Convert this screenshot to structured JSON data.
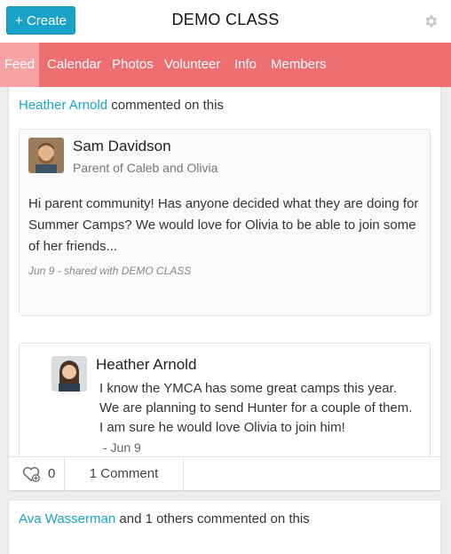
{
  "header": {
    "create_label": "+ Create",
    "class_title": "DEMO CLASS"
  },
  "nav": {
    "items": [
      {
        "label": "Feed",
        "active": true
      },
      {
        "label": "Calendar"
      },
      {
        "label": "Photos"
      },
      {
        "label": "Volunteer"
      },
      {
        "label": "Info"
      },
      {
        "label": "Members"
      }
    ]
  },
  "feed": {
    "card1": {
      "commenter": "Heather Arnold",
      "activity_suffix": "commented on this",
      "post": {
        "author": "Sam Davidson",
        "subtitle": "Parent of Caleb and Olivia",
        "text": "Hi parent community! Has anyone decided what they are doing for Summer Camps? We would love for Olivia to be able to join some of her friends...",
        "meta": "Jun 9 - shared with DEMO CLASS"
      },
      "comment": {
        "author": "Heather Arnold",
        "text": "I know the YMCA has some great camps this year. We are planning to send Hunter for a couple of them. I am sure he would love Olivia to join him!",
        "time": "- Jun 9"
      },
      "likes": "0",
      "comments_label": "1 Comment"
    },
    "card2": {
      "commenter": "Ava Wasserman",
      "activity_suffix": "and 1 others commented on this"
    }
  },
  "colors": {
    "accent": "#1aa3c8",
    "nav_bg": "#ee6f72",
    "nav_active": "#f5a3a5"
  }
}
